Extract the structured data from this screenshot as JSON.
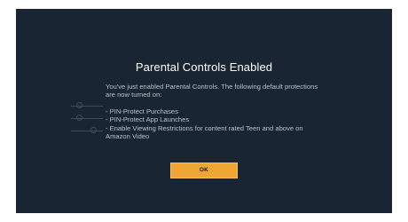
{
  "dialog": {
    "title": "Parental Controls Enabled",
    "intro": "You've just enabled Parental Controls. The following default protections are now turned on:",
    "protections": [
      "- PIN-Protect Purchases",
      "- PIN-Protect App Launches",
      "- Enable Viewing Restrictions for content rated Teen and above on Amazon Video"
    ],
    "ok_label": "OK"
  },
  "colors": {
    "screen_background": "#1a2533",
    "title_text": "#ffffff",
    "body_text": "#b7c0cb",
    "button_accent": "#f0a632"
  }
}
